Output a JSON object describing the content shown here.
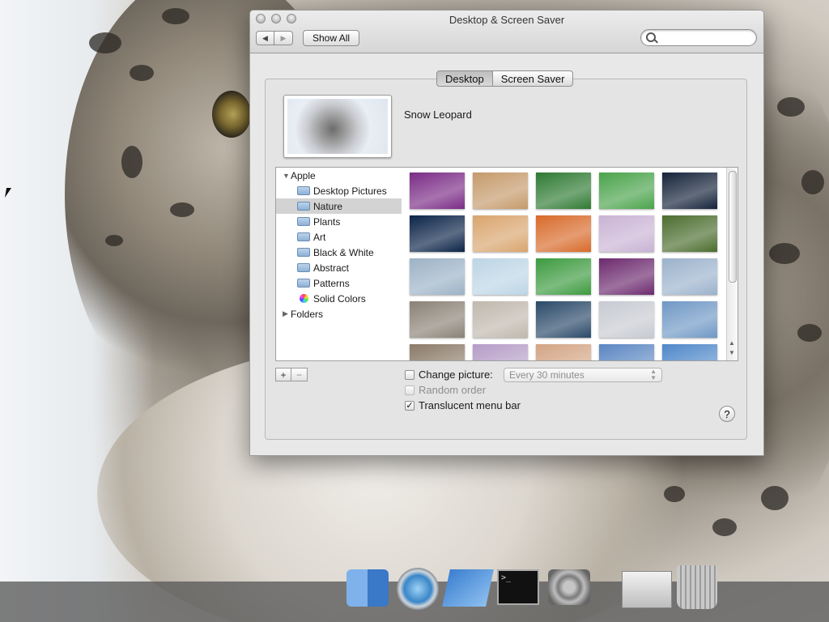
{
  "window": {
    "title": "Desktop & Screen Saver",
    "nav_back": "◀",
    "nav_forward": "▶",
    "show_all": "Show All",
    "search_placeholder": ""
  },
  "tabs": [
    {
      "label": "Desktop",
      "active": true
    },
    {
      "label": "Screen Saver",
      "active": false
    }
  ],
  "preview": {
    "name": "Snow Leopard"
  },
  "sources": {
    "apple": "Apple",
    "items": [
      "Desktop Pictures",
      "Nature",
      "Plants",
      "Art",
      "Black & White",
      "Abstract",
      "Patterns",
      "Solid Colors"
    ],
    "selected": "Nature",
    "folders": "Folders"
  },
  "thumbnails_colors": [
    [
      "#7b2c86",
      "#c59a6b",
      "#2f7a33",
      "#4aa34b",
      "#15233a"
    ],
    [
      "#0b2448",
      "#d9a56e",
      "#d86a2a",
      "#c9b3d4",
      "#4b6d2e"
    ],
    [
      "#9cb2c6",
      "#bcd5e5",
      "#3c9a3f",
      "#6c2a6e",
      "#9bb2cc"
    ],
    [
      "#8a8276",
      "#bfb8ad",
      "#2a4968",
      "#c7cad1",
      "#6f98c5"
    ],
    [
      "#8a7a68",
      "#b59cc7",
      "#d3a483",
      "#5a86c2",
      "#4e87c9"
    ]
  ],
  "controls": {
    "add": "+",
    "remove": "−",
    "change_picture": "Change picture:",
    "change_picture_checked": false,
    "interval": "Every 30 minutes",
    "random_order": "Random order",
    "random_order_checked": false,
    "translucent_menu_bar": "Translucent menu bar",
    "translucent_checked": true,
    "help": "?"
  },
  "dock": {
    "items": [
      "finder-icon",
      "safari-icon",
      "xcode-icon",
      "terminal-icon",
      "system-preferences-icon",
      "downloads-stack-icon",
      "trash-icon"
    ],
    "overlay_tools": [
      "keyboard-icon",
      "trackpad-icon",
      "list-icon",
      "return-key-icon",
      "window-icon",
      "lock-icon",
      "dropdown-arrow-icon"
    ]
  }
}
